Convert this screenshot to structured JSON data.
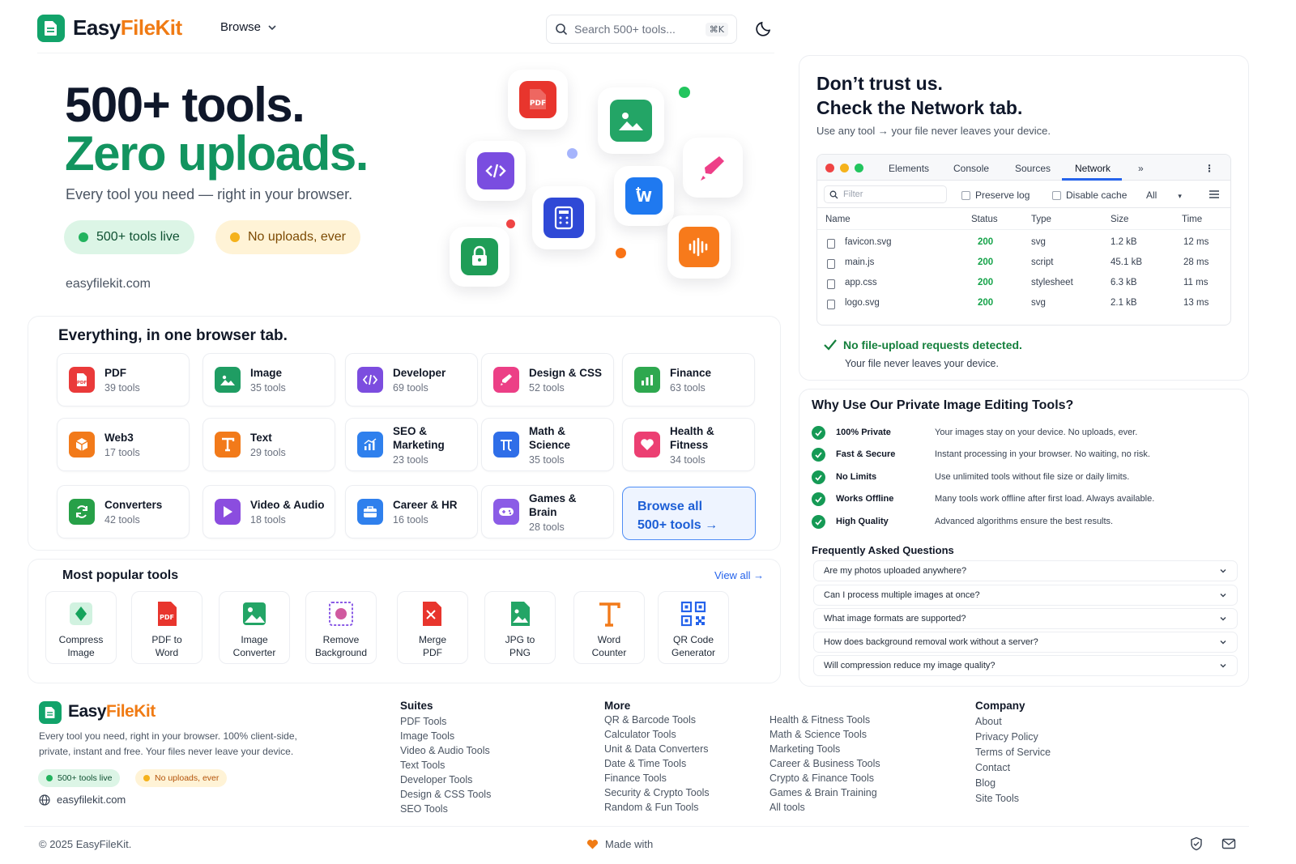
{
  "header": {
    "brand_part1": "Easy",
    "brand_part2": "FileKit",
    "browse_label": "Browse",
    "search_placeholder": "Search 500+ tools...",
    "search_shortcut": "⌘K",
    "theme_icon": "moon-icon"
  },
  "hero": {
    "title_line1": "500+ tools.",
    "title_line2": "Zero uploads.",
    "subtitle": "Every tool you need — right in your browser.",
    "pill_tools": "500+ tools live",
    "pill_uploads": "No uploads, ever",
    "url": "easyfilekit.com",
    "floating_icons": [
      "pdf-icon",
      "image-icon",
      "code-icon",
      "marker-icon",
      "word-icon",
      "calculator-icon",
      "lock-icon",
      "audio-wave-icon"
    ]
  },
  "categories": {
    "title": "Everything, in one browser tab.",
    "items": [
      {
        "name": "PDF",
        "count": "39 tools",
        "color": "#ea3a3a"
      },
      {
        "name": "Image",
        "count": "35 tools",
        "color": "#1f9d63"
      },
      {
        "name": "Developer",
        "count": "69 tools",
        "color": "#7c4ddf"
      },
      {
        "name": "Design & CSS",
        "count": "52 tools",
        "color": "#ec3f86"
      },
      {
        "name": "Finance",
        "count": "63 tools",
        "color": "#2ea84f"
      },
      {
        "name": "Web3",
        "count": "17 tools",
        "color": "#f27a1a"
      },
      {
        "name": "Text",
        "count": "29 tools",
        "color": "#f27a1a"
      },
      {
        "name": "SEO & Marketing",
        "count": "23 tools",
        "color": "#2f80ed"
      },
      {
        "name": "Math & Science",
        "count": "35 tools",
        "color": "#2f6ee8"
      },
      {
        "name": "Health & Fitness",
        "count": "34 tools",
        "color": "#ec3f72"
      },
      {
        "name": "Converters",
        "count": "42 tools",
        "color": "#27a048"
      },
      {
        "name": "Video & Audio",
        "count": "18 tools",
        "color": "#8b4ddf"
      },
      {
        "name": "Career & HR",
        "count": "16 tools",
        "color": "#2f80ed"
      },
      {
        "name": "Games & Brain",
        "count": "28 tools",
        "color": "#8b5ce6"
      }
    ],
    "browse_all_line1": "Browse all",
    "browse_all_line2": "500+ tools →"
  },
  "popular": {
    "title": "Most popular tools",
    "view_all": "View all →",
    "items": [
      {
        "line1": "Compress",
        "line2": "Image"
      },
      {
        "line1": "PDF to",
        "line2": "Word"
      },
      {
        "line1": "Image",
        "line2": "Converter"
      },
      {
        "line1": "Remove",
        "line2": "Background"
      },
      {
        "line1": "Merge",
        "line2": "PDF"
      },
      {
        "line1": "JPG to",
        "line2": "PNG"
      },
      {
        "line1": "Word",
        "line2": "Counter"
      },
      {
        "line1": "QR Code",
        "line2": "Generator"
      }
    ]
  },
  "network": {
    "title_line1": "Don’t trust us.",
    "title_line2": "Check the Network tab.",
    "subtitle": "Use any tool → your file never leaves your device.",
    "tabs": [
      "Elements",
      "Console",
      "Sources",
      "Network",
      "»"
    ],
    "filter_placeholder": "Filter",
    "preserve_log": "Preserve log",
    "disable_cache": "Disable cache",
    "throttle": "All",
    "columns": [
      "Name",
      "Status",
      "Type",
      "Size",
      "Time"
    ],
    "rows": [
      {
        "name": "favicon.svg",
        "status": "200",
        "type": "svg",
        "size": "1.2 kB",
        "time": "12 ms"
      },
      {
        "name": "main.js",
        "status": "200",
        "type": "script",
        "size": "45.1 kB",
        "time": "28 ms"
      },
      {
        "name": "app.css",
        "status": "200",
        "type": "stylesheet",
        "size": "6.3 kB",
        "time": "11 ms"
      },
      {
        "name": "logo.svg",
        "status": "200",
        "type": "svg",
        "size": "2.1 kB",
        "time": "13 ms"
      }
    ],
    "ok_text": "No file-upload requests detected.",
    "ok_sub": "Your file never leaves your device."
  },
  "why": {
    "title": "Why Use Our Private Image Editing Tools?",
    "items": [
      {
        "label": "100% Private",
        "desc": "Your images stay on your device. No uploads, ever."
      },
      {
        "label": "Fast & Secure",
        "desc": "Instant processing in your browser. No waiting, no risk."
      },
      {
        "label": "No Limits",
        "desc": "Use unlimited tools without file size or daily limits."
      },
      {
        "label": "Works Offline",
        "desc": "Many tools work offline after first load. Always available."
      },
      {
        "label": "High Quality",
        "desc": "Advanced algorithms ensure the best results."
      }
    ],
    "faq_title": "Frequently Asked Questions",
    "faqs": [
      "Are my photos uploaded anywhere?",
      "Can I process multiple images at once?",
      "What image formats are supported?",
      "How does background removal work without a server?",
      "Will compression reduce my image quality?"
    ]
  },
  "footer": {
    "brand_part1": "Easy",
    "brand_part2": "FileKit",
    "desc_line1": "Every tool you need, right in your browser. 100% client-side,",
    "desc_line2": "private, instant and free. Your files never leave your device.",
    "pill_tools": "500+ tools live",
    "pill_uploads": "No uploads, ever",
    "url": "easyfilekit.com",
    "suites_title": "Suites",
    "suites": [
      "PDF Tools",
      "Image Tools",
      "Video & Audio Tools",
      "Text Tools",
      "Developer Tools",
      "Design & CSS Tools",
      "SEO Tools"
    ],
    "more_title": "More",
    "more_col1": [
      "QR & Barcode Tools",
      "Calculator Tools",
      "Unit & Data Converters",
      "Date & Time Tools",
      "Finance Tools",
      "Security & Crypto Tools",
      "Random & Fun Tools"
    ],
    "more_col2": [
      "Health & Fitness Tools",
      "Math & Science Tools",
      "Marketing Tools",
      "Career & Business Tools",
      "Crypto & Finance Tools",
      "Games & Brain Training",
      "All tools"
    ],
    "company_title": "Company",
    "company": [
      "About",
      "Privacy Policy",
      "Terms of Service",
      "Contact",
      "Blog",
      "Site Tools"
    ],
    "copyright": "© 2025 EasyFileKit.",
    "made_with": "Made with"
  },
  "colors": {
    "brand_green": "#12a36a",
    "brand_orange": "#f07b14",
    "hero_green": "#12945f",
    "link_blue": "#2563eb"
  }
}
